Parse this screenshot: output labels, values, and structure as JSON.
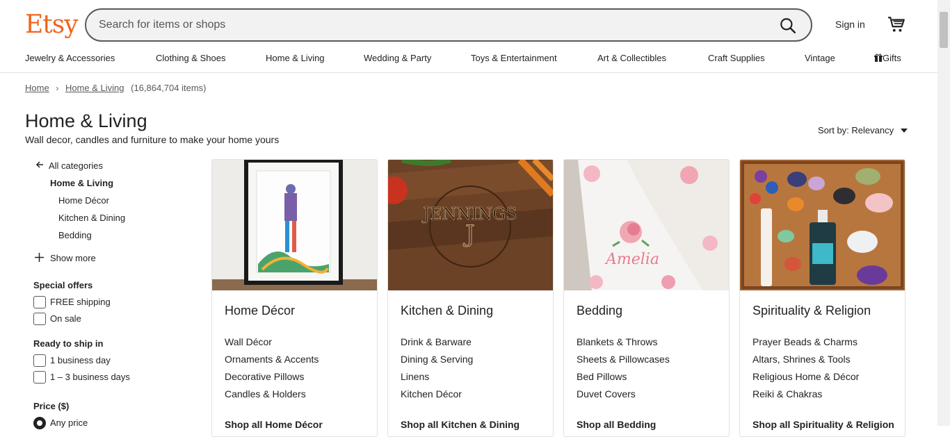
{
  "brand": {
    "logo_text": "Etsy",
    "accent": "#f1641e"
  },
  "search": {
    "placeholder": "Search for items or shops",
    "icon": "search-icon"
  },
  "header": {
    "signin_label": "Sign in",
    "cart_icon": "cart-icon"
  },
  "nav": {
    "items": [
      "Jewelry & Accessories",
      "Clothing & Shoes",
      "Home & Living",
      "Wedding & Party",
      "Toys & Entertainment",
      "Art & Collectibles",
      "Craft Supplies",
      "Vintage",
      "Gifts"
    ],
    "gift_icon": "gift-icon"
  },
  "breadcrumb": {
    "home": "Home",
    "current": "Home & Living",
    "count": "(16,864,704 items)"
  },
  "page": {
    "title": "Home & Living",
    "subtitle": "Wall decor, candles and furniture to make your home yours"
  },
  "sort": {
    "label": "Sort by:",
    "value": "Relevancy"
  },
  "sidebar": {
    "all_categories": "All categories",
    "current": "Home & Living",
    "subcategories": [
      "Home Décor",
      "Kitchen & Dining",
      "Bedding"
    ],
    "show_more": "Show more",
    "special_offers": {
      "heading": "Special offers",
      "options": [
        "FREE shipping",
        "On sale"
      ]
    },
    "ready_to_ship": {
      "heading": "Ready to ship in",
      "options": [
        "1 business day",
        "1 – 3 business days"
      ]
    },
    "price": {
      "heading": "Price ($)",
      "selected": "Any price"
    }
  },
  "cards": [
    {
      "title": "Home Décor",
      "links": [
        "Wall Décor",
        "Ornaments & Accents",
        "Decorative Pillows",
        "Candles & Holders"
      ],
      "more": "Shop all Home Décor"
    },
    {
      "title": "Kitchen & Dining",
      "links": [
        "Drink & Barware",
        "Dining & Serving",
        "Linens",
        "Kitchen Décor"
      ],
      "more": "Shop all Kitchen & Dining"
    },
    {
      "title": "Bedding",
      "links": [
        "Blankets & Throws",
        "Sheets & Pillowcases",
        "Bed Pillows",
        "Duvet Covers"
      ],
      "more": "Shop all Bedding"
    },
    {
      "title": "Spirituality & Religion",
      "links": [
        "Prayer Beads & Charms",
        "Altars, Shrines & Tools",
        "Religious Home & Décor",
        "Reiki & Chakras"
      ],
      "more": "Shop all Spirituality & Religion"
    }
  ]
}
